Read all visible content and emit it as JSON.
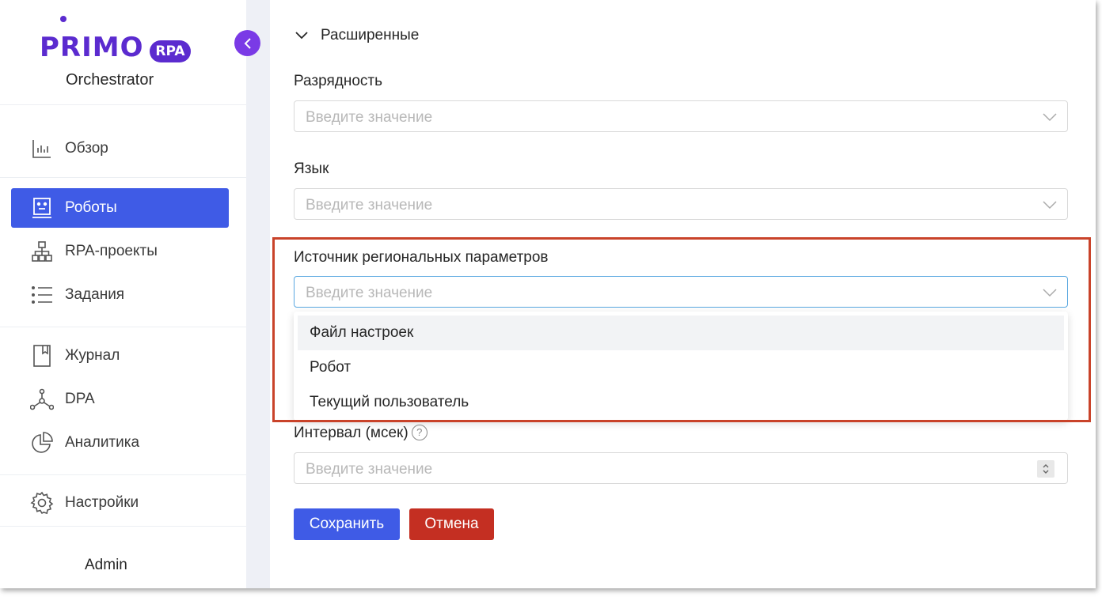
{
  "brand": {
    "logo_text": "PRIMO",
    "logo_badge": "RPA",
    "subtitle": "Orchestrator",
    "accent_color": "#5b2bcf"
  },
  "sidebar": {
    "items": [
      {
        "label": "Обзор",
        "icon": "bar-chart-icon"
      },
      {
        "label": "Роботы",
        "icon": "robot-icon",
        "active": true
      },
      {
        "label": "RPA-проекты",
        "icon": "hierarchy-icon"
      },
      {
        "label": "Задания",
        "icon": "list-icon"
      },
      {
        "label": "Журнал",
        "icon": "bookmark-icon"
      },
      {
        "label": "DPA",
        "icon": "network-icon"
      },
      {
        "label": "Аналитика",
        "icon": "pie-chart-icon"
      },
      {
        "label": "Настройки",
        "icon": "gear-icon"
      }
    ],
    "user": "Admin"
  },
  "form": {
    "section_title": "Расширенные",
    "fields": {
      "bitness": {
        "label": "Разрядность",
        "placeholder": "Введите значение"
      },
      "language": {
        "label": "Язык",
        "placeholder": "Введите значение"
      },
      "regional": {
        "label": "Источник региональных параметров",
        "placeholder": "Введите значение"
      },
      "interval": {
        "label": "Интервал (мсек)",
        "placeholder": "Введите значение"
      }
    },
    "dropdown_options": [
      "Файл настроек",
      "Робот",
      "Текущий пользователь"
    ],
    "save_label": "Сохранить",
    "cancel_label": "Отмена"
  },
  "colors": {
    "primary": "#3f5be6",
    "danger": "#c42f22",
    "highlight": "#c9432a"
  }
}
